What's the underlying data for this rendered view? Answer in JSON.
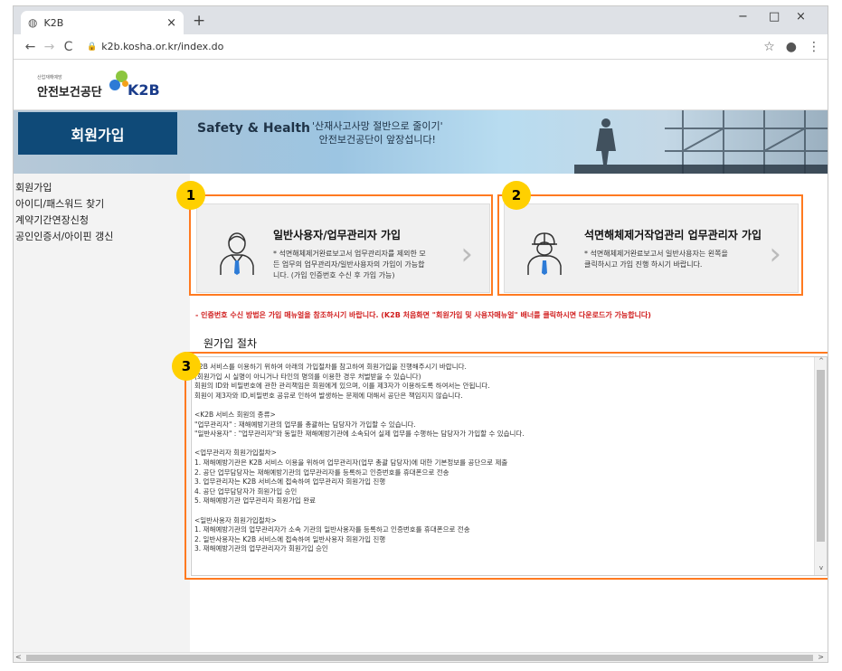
{
  "browser": {
    "tab_title": "K2B",
    "tab_close": "×",
    "new_tab": "+",
    "minimize": "−",
    "maximize": "□",
    "close": "×",
    "back": "←",
    "forward": "→",
    "reload": "C",
    "lock": "🔒",
    "url": "k2b.kosha.or.kr/index.do",
    "bookmark": "☆",
    "account": "●",
    "menu": "⋮"
  },
  "header": {
    "logo_small": "산업재해예방",
    "logo_ko": "안전보건공단",
    "logo_en": "K2B"
  },
  "banner": {
    "title": "Safety & Health",
    "copy_line1": "'산재사고사망 절반으로 줄이기'",
    "copy_line2": "안전보건공단이 앞장섭니다!"
  },
  "sidebar": {
    "title": "회원가입",
    "items": [
      {
        "label": "회원가입"
      },
      {
        "label": "아이디/패스워드 찾기"
      },
      {
        "label": "계약기간연장신청"
      },
      {
        "label": "공인인증서/아이핀 갱신"
      }
    ]
  },
  "badges": [
    "1",
    "2",
    "3"
  ],
  "cards": [
    {
      "title": "일반사용자/업무관리자 가입",
      "desc": "* 석면해체제거완료보고서 업무관리자를 제외한 모든 업무의 업무관리자/일반사용자의 가입이 가능합니다. (가입 인증번호 수신 후 가입 가능)",
      "arrow": "›"
    },
    {
      "title": "석면해체제거작업관리 업무관리자 가입",
      "desc": "* 석면해체제거완료보고서 일반사용자는 왼쪽을 클릭하시고 가입 진행 하시기 바랍니다.",
      "arrow": "›"
    }
  ],
  "notice": "- 인증번호 수신 방법은 가입 매뉴얼을 참조하시기 바랍니다. (K2B 처음화면 \"회원가입 및 사용자매뉴얼\" 배너를 클릭하시면 다운로드가 가능합니다)",
  "procedure": {
    "title": "원가입 절차",
    "lines": [
      "K2B 서비스를 이용하기 위하여 아래의 가입절차를 참고하여 회원가입을 진행해주시기 바랍니다.",
      "(회원가입 시 실명이 아니거나 타인의 명의를 이용한 경우 처벌받을 수 있습니다)",
      "회원의 ID와 비밀번호에 관한 관리책임은 회원에게 있으며, 이를 제3자가 이용하도록 하여서는 안됩니다.",
      "회원이 제3자와 ID,비밀번호 공유로 인하여 발생하는 문제에 대해서 공단은 책임지지 않습니다.",
      "",
      "<K2B 서비스 회원의 종류>",
      "\"업무관리자\" : 재해예방기관의 업무를 총괄하는 담당자가 가입할 수 있습니다.",
      "\"일반사용자\" : \"업무관리자\"와 동일한 재해예방기관에 소속되어 실제 업무를 수행하는 담당자가 가입할 수 있습니다.",
      "",
      "<업무관리자 회원가입절차>",
      "1. 재해예방기관은 K2B 서비스 이용을 위하여 업무관리자(업무 총괄 담당자)에 대한 기본정보를 공단으로 제출",
      "2. 공단 업무담당자는 재해예방기관의 업무관리자를 등록하고 인증번호를 휴대폰으로 전송",
      "3. 업무관리자는 K2B 서비스에 접속하여 업무관리자 회원가입 진행",
      "4. 공단 업무담당자가 회원가입 승인",
      "5. 재해예방기관 업무관리자 회원가입 완료",
      "",
      "<일반사용자 회원가입절차>",
      "1. 재해예방기관의 업무관리자가 소속 기관의 일반사용자를 등록하고 인증번호를 휴대폰으로 전송",
      "2. 일반사용자는 K2B 서비스에 접속하여 일반사용자 회원가입 진행",
      "3. 재해예방기관의 업무관리자가 회원가입 승인"
    ]
  },
  "scroll": {
    "up": "^",
    "down": "v",
    "left": "<",
    "right": ">"
  }
}
